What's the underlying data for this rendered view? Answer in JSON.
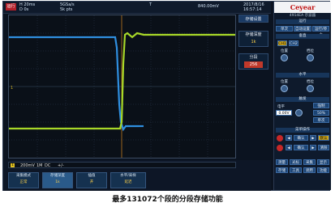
{
  "topbar": {
    "run_label": "运行",
    "timebase": "H 20ms",
    "delay": "D 0s",
    "sample_rate": "5GSa/s",
    "memory_depth": "5k pts",
    "trigger_level": "T",
    "trigger_extra": "840.00mV",
    "date": "2017/8/16",
    "time": "16:57:14"
  },
  "side_panel": {
    "save_label": "存储设置",
    "store_depth_label": "存储深度",
    "store_depth_value": "1k",
    "segment_label": "分段",
    "segment_value": "256"
  },
  "channel_bar": {
    "channel": "1",
    "scale": "200mV",
    "coupling": "DC",
    "bw": "1M",
    "extra": "+/-"
  },
  "bottom_menu": [
    {
      "label": "采集模式",
      "value": "正常"
    },
    {
      "label": "存储深度",
      "value": "1k"
    },
    {
      "label": "插值",
      "value": "开"
    },
    {
      "label": "水平/采样",
      "value": "延迟"
    }
  ],
  "right_panel": {
    "logo": "Ceyear",
    "model": "4914EA 示波器",
    "run_control": "运行",
    "buttons_row1": [
      "单次",
      "自动设置",
      "运行/停止"
    ],
    "vertical": "垂直",
    "ch_labels": [
      "CH1",
      "CH2"
    ],
    "pos_label": "位置",
    "scale_label": "档位",
    "horizontal": "水平",
    "h_pos": "位置",
    "h_scale": "档位",
    "trigger": "触发",
    "trig_mode": "自动",
    "level_label": "电平",
    "level_value": "0.00V",
    "trig_btn1": "强制",
    "trig_btn2": "50%",
    "trig_btn3": "单次",
    "measure": "菜单操作",
    "confirm": "确认",
    "menu_items": [
      "测量",
      "光标",
      "采集",
      "显示",
      "存储",
      "工具",
      "调用",
      "功能"
    ]
  },
  "caption": "最多131072个段的分段存储功能"
}
